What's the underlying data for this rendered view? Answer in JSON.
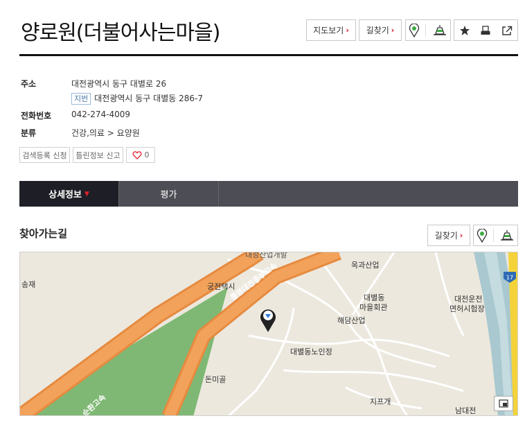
{
  "page": {
    "title": "양로원(더불어사는마을)"
  },
  "header_buttons": {
    "map_view": "지도보기",
    "directions": "길찾기"
  },
  "info": {
    "address_label": "주소",
    "address": "대전광역시 동구 대별로 26",
    "jibun_badge": "지번",
    "jibun_address": "대전광역시 동구 대별동 286-7",
    "phone_label": "전화번호",
    "phone": "042-274-4009",
    "category_label": "분류",
    "category": "건강,의료 > 요양원"
  },
  "small_buttons": {
    "register": "검색등록 신청",
    "report": "틀린정보 신고",
    "like_count": "0"
  },
  "tabs": [
    {
      "label": "상세정보"
    },
    {
      "label": "평가"
    }
  ],
  "section": {
    "title": "찾아가는길",
    "directions": "길찾기"
  },
  "map": {
    "labels": {
      "songjae": "송재",
      "taxi": "궁전택시",
      "expressway1": "통영대전중부고속",
      "expressway2": "순환고속",
      "okgwa": "옥과산업",
      "daebyeol_hall": "대별동",
      "daebyeol_hall2": "마을회관",
      "haedam": "해담산업",
      "driving": "대전운전",
      "driving2": "면허시험장",
      "nursing": "대별동노인정",
      "donmigol": "돈미골",
      "jipgae": "지프개",
      "namdaejeon": "남대전",
      "top_cut": "대성산업개발",
      "route17": "17"
    }
  },
  "colors": {
    "accent_red": "#d0021b",
    "tab_dark": "#1e1f26",
    "tab_bar": "#4d4d55"
  }
}
